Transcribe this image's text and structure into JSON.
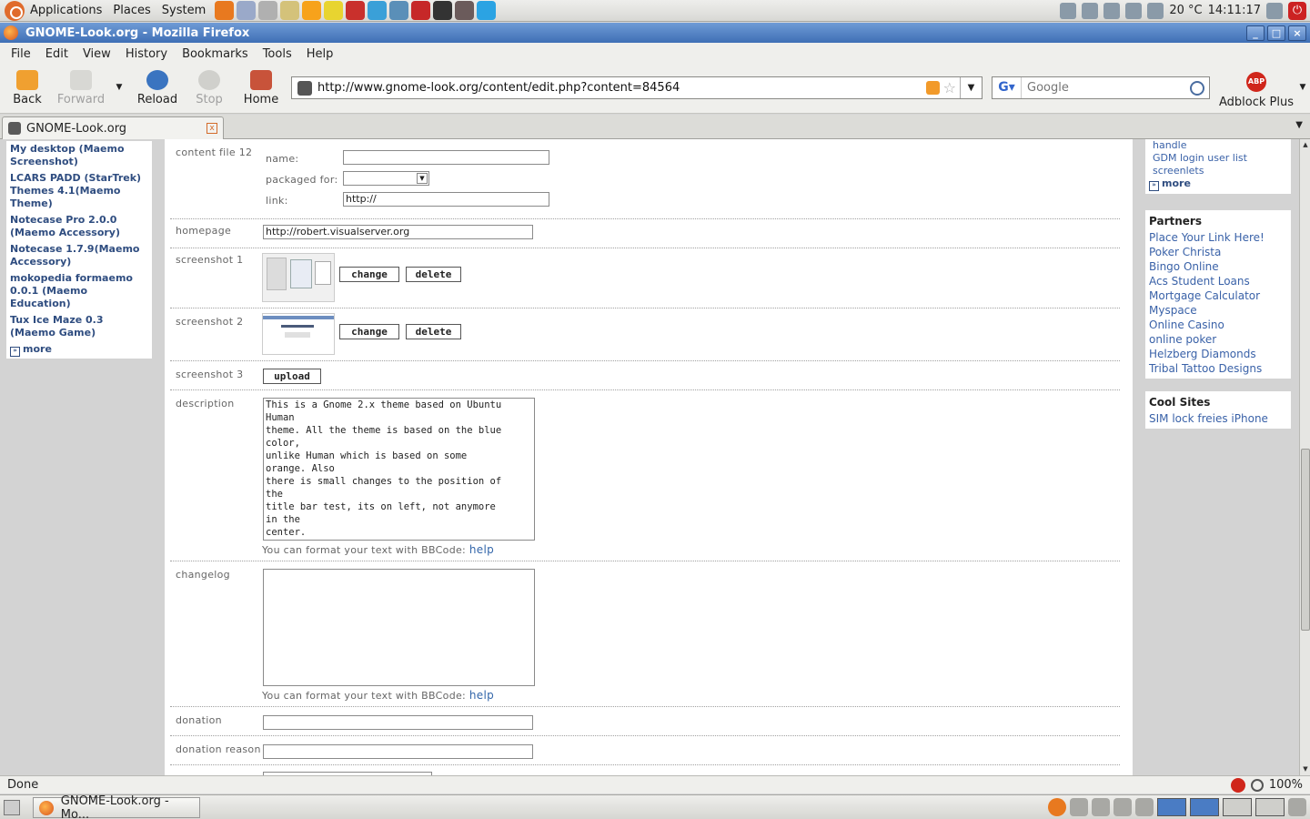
{
  "top_panel": {
    "menus": [
      "Applications",
      "Places",
      "System"
    ],
    "launcher_colors": [
      "#e8791f",
      "#9aa9c9",
      "#b0b0b0",
      "#d4c27a",
      "#f7a21b",
      "#e8d430",
      "#c9302c",
      "#3aa0d8",
      "#5a8fb8",
      "#c62828",
      "#333333",
      "#6b5b5b",
      "#2ba3e3"
    ],
    "temperature": "20 °C",
    "clock": "14:11:17"
  },
  "window": {
    "title": "GNOME-Look.org - Mozilla Firefox"
  },
  "menubar": [
    "File",
    "Edit",
    "View",
    "History",
    "Bookmarks",
    "Tools",
    "Help"
  ],
  "navbar": {
    "back": "Back",
    "forward": "Forward",
    "reload": "Reload",
    "stop": "Stop",
    "home": "Home",
    "url": "http://www.gnome-look.org/content/edit.php?content=84564",
    "search_placeholder": "Google",
    "adblock": "Adblock Plus"
  },
  "tab": {
    "title": "GNOME-Look.org"
  },
  "left_sidebar": {
    "links": [
      "My desktop (Maemo Screenshot)",
      "LCARS PADD (StarTrek) Themes 4.1(Maemo Theme)",
      "Notecase Pro 2.0.0 (Maemo Accessory)",
      "Notecase 1.7.9(Maemo Accessory)",
      "mokopedia formaemo 0.0.1 (Maemo Education)",
      "Tux Ice Maze 0.3 (Maemo Game)"
    ],
    "more": "more"
  },
  "form": {
    "content_file_label": "content file 12",
    "name_label": "name:",
    "packaged_label": "packaged for:",
    "link_label": "link:",
    "link_value": "http://",
    "homepage_label": "homepage",
    "homepage_value": "http://robert.visualserver.org",
    "screenshot1_label": "screenshot 1",
    "screenshot2_label": "screenshot 2",
    "screenshot3_label": "screenshot 3",
    "change": "change",
    "delete": "delete",
    "upload": "upload",
    "description_label": "description",
    "description_text": "This is a Gnome 2.x theme based on Ubuntu\nHuman\ntheme. All the theme is based on the blue\ncolor,\nunlike Human which is based on some\norange. Also\nthere is small changes to the position of\nthe\ntitle bar test, its on left, not anymore\nin the\ncenter.",
    "bbcode_hint": "You can format your text with BBCode:",
    "help": "help",
    "changelog_label": "changelog",
    "donation_label": "donation",
    "donation_reason_label": "donation reason"
  },
  "right_sidebar": {
    "top_links": [
      "handle",
      "GDM login user list",
      "screenlets"
    ],
    "more": "more",
    "partners_title": "Partners",
    "partners": [
      "Place Your Link Here!",
      "Poker Christa",
      "Bingo Online",
      "Acs Student Loans",
      "Mortgage Calculator",
      "Myspace",
      "Online Casino",
      "online poker",
      "Helzberg Diamonds",
      "Tribal Tattoo Designs"
    ],
    "cool_title": "Cool Sites",
    "cool": [
      "SIM lock freies iPhone"
    ]
  },
  "statusbar": {
    "status": "Done",
    "zoom": "100%"
  },
  "taskbar": {
    "window_button": "GNOME-Look.org - Mo..."
  }
}
